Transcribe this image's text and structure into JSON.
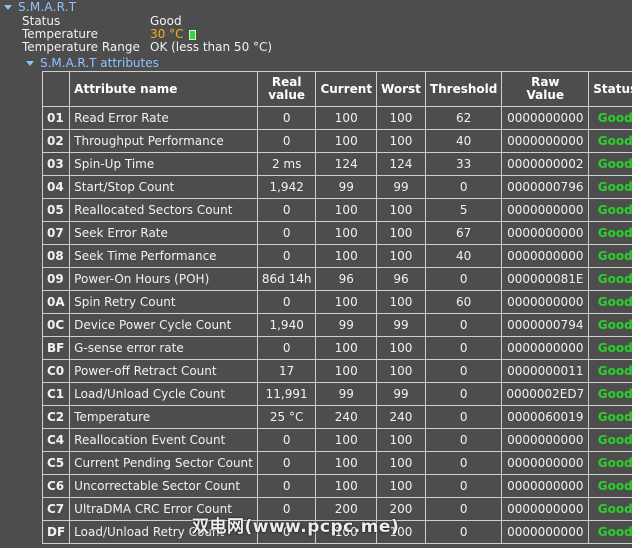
{
  "section": {
    "title": "S.M.A.R.T",
    "status_label": "Status",
    "status_value": "Good",
    "temperature_label": "Temperature",
    "temperature_value": "30 °C",
    "temperature_range_label": "Temperature Range",
    "temperature_range_value": "OK (less than 50 °C)",
    "temperature_icon": "thermometer-icon"
  },
  "attributes": {
    "title": "S.M.A.R.T attributes",
    "headers": [
      "",
      "Attribute name",
      "Real\nvalue",
      "Current",
      "Worst",
      "Threshold",
      "Raw\nValue",
      "Status"
    ],
    "header_lines": {
      "real_1": "Real",
      "real_2": "value",
      "raw_1": "Raw",
      "raw_2": "Value"
    },
    "rows": [
      {
        "id": "01",
        "name": "Read Error Rate",
        "real": "0",
        "current": "100",
        "worst": "100",
        "threshold": "62",
        "raw": "0000000000",
        "status": "Good"
      },
      {
        "id": "02",
        "name": "Throughput Performance",
        "real": "0",
        "current": "100",
        "worst": "100",
        "threshold": "40",
        "raw": "0000000000",
        "status": "Good"
      },
      {
        "id": "03",
        "name": "Spin-Up Time",
        "real": "2 ms",
        "current": "124",
        "worst": "124",
        "threshold": "33",
        "raw": "0000000002",
        "status": "Good"
      },
      {
        "id": "04",
        "name": "Start/Stop Count",
        "real": "1,942",
        "current": "99",
        "worst": "99",
        "threshold": "0",
        "raw": "0000000796",
        "status": "Good"
      },
      {
        "id": "05",
        "name": "Reallocated Sectors Count",
        "real": "0",
        "current": "100",
        "worst": "100",
        "threshold": "5",
        "raw": "0000000000",
        "status": "Good"
      },
      {
        "id": "07",
        "name": "Seek Error Rate",
        "real": "0",
        "current": "100",
        "worst": "100",
        "threshold": "67",
        "raw": "0000000000",
        "status": "Good"
      },
      {
        "id": "08",
        "name": "Seek Time Performance",
        "real": "0",
        "current": "100",
        "worst": "100",
        "threshold": "40",
        "raw": "0000000000",
        "status": "Good"
      },
      {
        "id": "09",
        "name": "Power-On Hours (POH)",
        "real": "86d 14h",
        "current": "96",
        "worst": "96",
        "threshold": "0",
        "raw": "000000081E",
        "status": "Good"
      },
      {
        "id": "0A",
        "name": "Spin Retry Count",
        "real": "0",
        "current": "100",
        "worst": "100",
        "threshold": "60",
        "raw": "0000000000",
        "status": "Good"
      },
      {
        "id": "0C",
        "name": "Device Power Cycle Count",
        "real": "1,940",
        "current": "99",
        "worst": "99",
        "threshold": "0",
        "raw": "0000000794",
        "status": "Good"
      },
      {
        "id": "BF",
        "name": "G-sense error rate",
        "real": "0",
        "current": "100",
        "worst": "100",
        "threshold": "0",
        "raw": "0000000000",
        "status": "Good"
      },
      {
        "id": "C0",
        "name": "Power-off Retract Count",
        "real": "17",
        "current": "100",
        "worst": "100",
        "threshold": "0",
        "raw": "0000000011",
        "status": "Good"
      },
      {
        "id": "C1",
        "name": "Load/Unload Cycle Count",
        "real": "11,991",
        "current": "99",
        "worst": "99",
        "threshold": "0",
        "raw": "0000002ED7",
        "status": "Good"
      },
      {
        "id": "C2",
        "name": "Temperature",
        "real": "25 °C",
        "current": "240",
        "worst": "240",
        "threshold": "0",
        "raw": "0000060019",
        "status": "Good"
      },
      {
        "id": "C4",
        "name": "Reallocation Event Count",
        "real": "0",
        "current": "100",
        "worst": "100",
        "threshold": "0",
        "raw": "0000000000",
        "status": "Good"
      },
      {
        "id": "C5",
        "name": "Current Pending Sector Count",
        "real": "0",
        "current": "100",
        "worst": "100",
        "threshold": "0",
        "raw": "0000000000",
        "status": "Good"
      },
      {
        "id": "C6",
        "name": "Uncorrectable Sector Count",
        "real": "0",
        "current": "100",
        "worst": "100",
        "threshold": "0",
        "raw": "0000000000",
        "status": "Good"
      },
      {
        "id": "C7",
        "name": "UltraDMA CRC Error Count",
        "real": "0",
        "current": "200",
        "worst": "200",
        "threshold": "0",
        "raw": "0000000000",
        "status": "Good"
      },
      {
        "id": "DF",
        "name": "Load/Unload Retry Count",
        "real": "0",
        "current": "100",
        "worst": "100",
        "threshold": "0",
        "raw": "0000000000",
        "status": "Good"
      }
    ]
  },
  "watermark": "双电网(www.pcpc.me)",
  "colors": {
    "background": "#4d4d4d",
    "header_link": "#8fc3ff",
    "temperature": "#f2b21c",
    "status_good": "#2ad12a",
    "grid": "#cfcfcf"
  }
}
